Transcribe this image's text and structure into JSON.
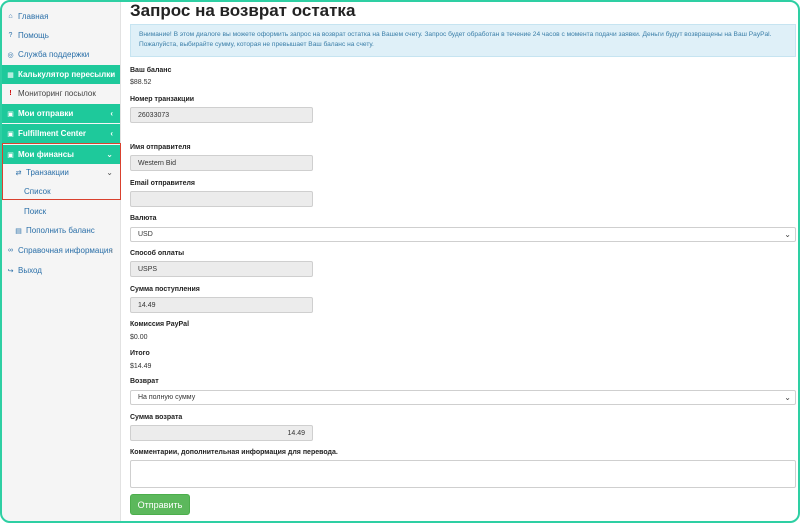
{
  "sidebar": {
    "items": [
      {
        "label": "Главная",
        "icon": "home-icon"
      },
      {
        "label": "Помощь",
        "icon": "help-icon"
      },
      {
        "label": "Служба поддержки",
        "icon": "support-icon"
      },
      {
        "label": "Калькулятор пересылки",
        "icon": "calculator-icon"
      },
      {
        "label": "Мониторинг посылок",
        "icon": "alert-icon"
      },
      {
        "label": "Мои отправки",
        "icon": "cart-icon"
      },
      {
        "label": "Fulfillment Center",
        "icon": "cart-icon"
      },
      {
        "label": "Мои финансы",
        "icon": "cart-icon"
      },
      {
        "label": "Транзакции",
        "icon": "exchange-icon"
      },
      {
        "label": "Список"
      },
      {
        "label": "Поиск"
      },
      {
        "label": "Пополнить баланс",
        "icon": "money-icon"
      },
      {
        "label": "Справочная информация",
        "icon": "link-icon"
      },
      {
        "label": "Выход",
        "icon": "logout-icon"
      }
    ]
  },
  "page": {
    "title": "Запрос на возврат остатка",
    "alert": "Внимание! В этом диалоге вы можете оформить запрос на возврат остатка на Вашем счету. Запрос будет обработан в течение 24 часов с момента подачи заявки. Деньги будут возвращены на Ваш PayPal. Пожалуйста, выбирайте сумму, которая не превышает Ваш баланс на счету."
  },
  "form": {
    "balance_label": "Ваш баланс",
    "balance_value": "$88.52",
    "transaction_label": "Номер транзакции",
    "transaction_value": "26033073",
    "sender_name_label": "Имя отправителя",
    "sender_name_value": "Western Bid",
    "sender_email_label": "Email отправителя",
    "sender_email_value": "",
    "currency_label": "Валюта",
    "currency_value": "USD",
    "payment_method_label": "Способ оплаты",
    "payment_method_value": "USPS",
    "incoming_amount_label": "Сумма поступления",
    "incoming_amount_value": "14.49",
    "paypal_fee_label": "Комиссия PayPal",
    "paypal_fee_value": "$0.00",
    "total_label": "Итого",
    "total_value": "$14.49",
    "refund_label": "Возврат",
    "refund_value": "На полную сумму",
    "refund_amount_label": "Сумма возрата",
    "refund_amount_value": "14.49",
    "comments_label": "Комментарии, дополнительная информация для перевода.",
    "comments_value": "",
    "submit_label": "Отправить"
  },
  "colors": {
    "accent": "#1ec99b",
    "link": "#2a6fa8",
    "highlight": "#d9412e",
    "submit": "#5cb85c"
  }
}
